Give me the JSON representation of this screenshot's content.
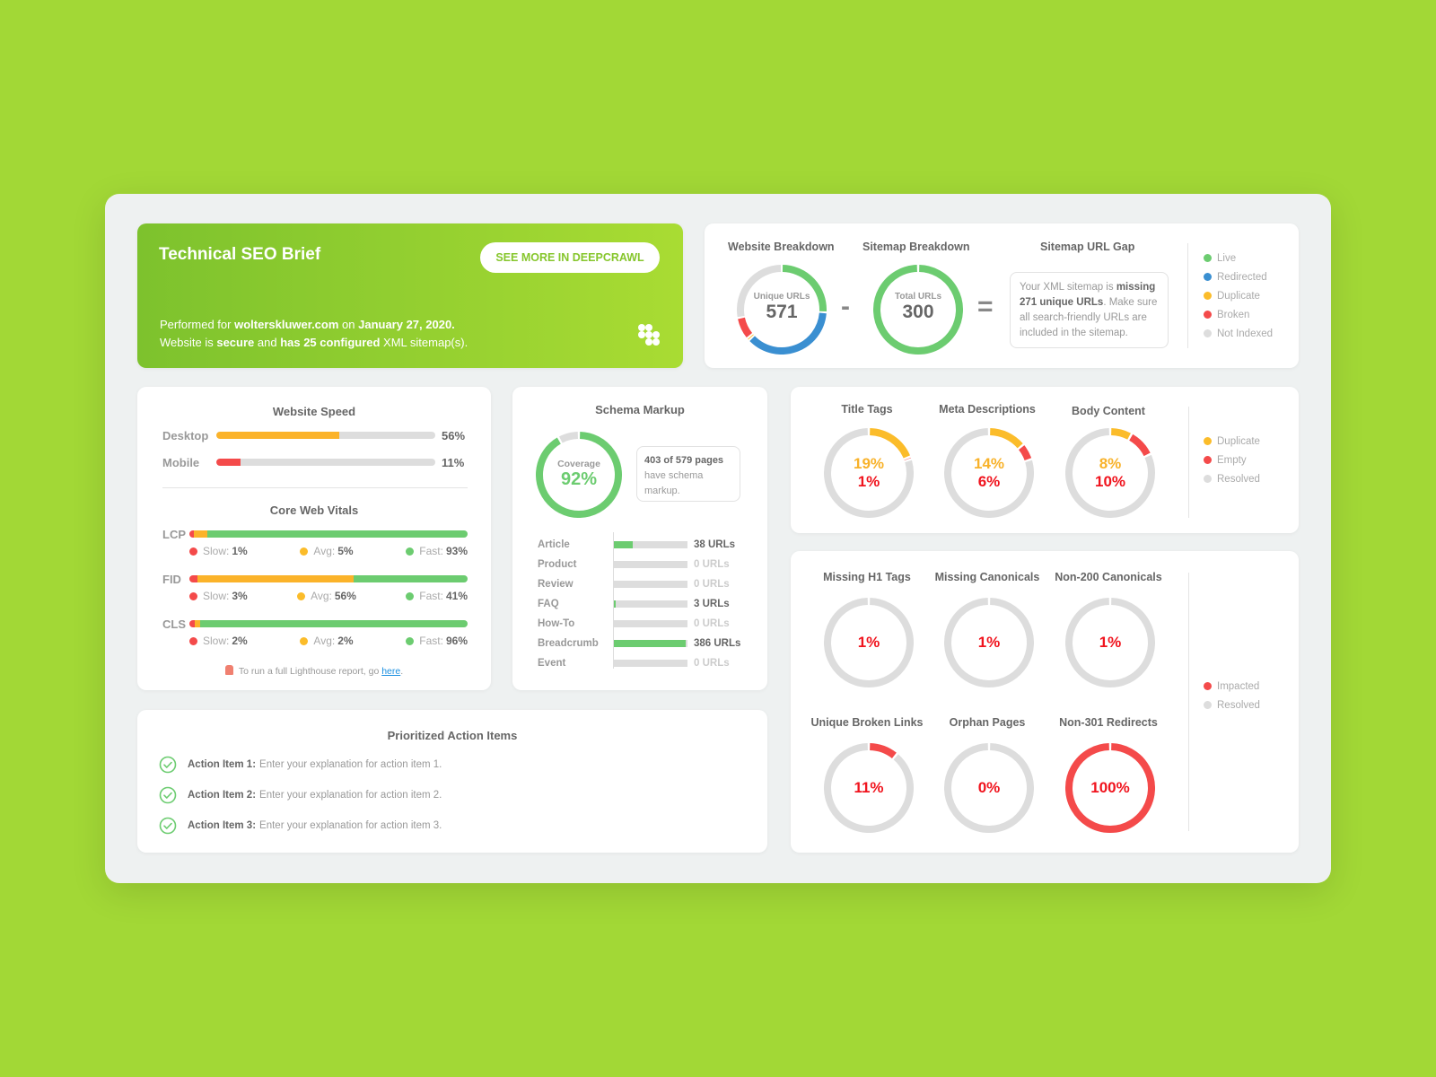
{
  "colors": {
    "green": "#6ccc70",
    "blue": "#3a8fd1",
    "yellow": "#fbbc2a",
    "red": "#f44a4a",
    "grey": "#dddddd",
    "text_red": "#f0141e",
    "text_yellow": "#f8b22a"
  },
  "hero": {
    "title": "Technical SEO Brief",
    "cta_label": "SEE MORE IN DEEPCRAWL",
    "line1_prefix": "Performed for ",
    "domain": "wolterskluwer.com",
    "line1_mid": " on ",
    "date": "January 27, 2020.",
    "line2_prefix": "Website is ",
    "secure": "secure",
    "line2_mid": " and ",
    "sitemaps": "has 25 configured",
    "line2_suffix": " XML sitemap(s).",
    "logo_icon": "deepcrawl-dots-icon"
  },
  "breakdown": {
    "website_title": "Website Breakdown",
    "website_label": "Unique URLs",
    "website_value": "571",
    "website_segments": [
      {
        "name": "Live",
        "pct": 26,
        "color": "#6ccc70"
      },
      {
        "name": "Redirected",
        "pct": 37,
        "color": "#3a8fd1"
      },
      {
        "name": "Duplicate",
        "pct": 1,
        "color": "#fbbc2a"
      },
      {
        "name": "Broken",
        "pct": 8,
        "color": "#f44a4a"
      },
      {
        "name": "Not Indexed",
        "pct": 28,
        "color": "#dddddd"
      }
    ],
    "minus": "-",
    "sitemap_title": "Sitemap Breakdown",
    "sitemap_label": "Total URLs",
    "sitemap_value": "300",
    "sitemap_segments": [
      {
        "name": "Live",
        "pct": 100,
        "color": "#6ccc70"
      }
    ],
    "equals": "=",
    "gap_title": "Sitemap URL Gap",
    "gap_text_prefix": "Your XML sitemap is ",
    "gap_text_bold": "missing 271 unique URLs",
    "gap_text_suffix": ". Make sure all search-friendly URLs are included in the sitemap.",
    "legend": [
      {
        "label": "Live",
        "color": "#6ccc70"
      },
      {
        "label": "Redirected",
        "color": "#3a8fd1"
      },
      {
        "label": "Duplicate",
        "color": "#fbbc2a"
      },
      {
        "label": "Broken",
        "color": "#f44a4a"
      },
      {
        "label": "Not Indexed",
        "color": "#dddddd"
      }
    ]
  },
  "speed": {
    "title": "Website Speed",
    "rows": [
      {
        "label": "Desktop",
        "value": "56%",
        "pct": 56,
        "color": "#fbb32a"
      },
      {
        "label": "Mobile",
        "value": "11%",
        "pct": 11,
        "color": "#f44a4a"
      }
    ],
    "cwv_title": "Core Web Vitals",
    "cwv": [
      {
        "name": "LCP",
        "slow": 1,
        "avg": 5,
        "fast": 93,
        "slow_label": "Slow:",
        "slow_value": "1%",
        "avg_label": "Avg:",
        "avg_value": "5%",
        "fast_label": "Fast:",
        "fast_value": "93%"
      },
      {
        "name": "FID",
        "slow": 3,
        "avg": 56,
        "fast": 41,
        "slow_label": "Slow:",
        "slow_value": "3%",
        "avg_label": "Avg:",
        "avg_value": "56%",
        "fast_label": "Fast:",
        "fast_value": "41%"
      },
      {
        "name": "CLS",
        "slow": 2,
        "avg": 2,
        "fast": 96,
        "slow_label": "Slow:",
        "slow_value": "2%",
        "avg_label": "Avg:",
        "avg_value": "2%",
        "fast_label": "Fast:",
        "fast_value": "96%"
      }
    ],
    "note_prefix": "To run a full Lighthouse report, go ",
    "note_link": "here",
    "note_suffix": "."
  },
  "schema": {
    "title": "Schema Markup",
    "coverage_label": "Coverage",
    "coverage_value": "92%",
    "coverage_pct": 92,
    "box_bold": "403 of 579 pages",
    "box_text": "have schema markup.",
    "rows": [
      {
        "name": "Article",
        "value": "38 URLs",
        "pct": 26,
        "active": true
      },
      {
        "name": "Product",
        "value": "0 URLs",
        "pct": 0,
        "active": false
      },
      {
        "name": "Review",
        "value": "0 URLs",
        "pct": 0,
        "active": false
      },
      {
        "name": "FAQ",
        "value": "3 URLs",
        "pct": 2,
        "active": true
      },
      {
        "name": "How-To",
        "value": "0 URLs",
        "pct": 0,
        "active": false
      },
      {
        "name": "Breadcrumb",
        "value": "386 URLs",
        "pct": 97,
        "active": true
      },
      {
        "name": "Event",
        "value": "0 URLs",
        "pct": 0,
        "active": false
      }
    ]
  },
  "content": {
    "rings": [
      {
        "title": "Title Tags",
        "duplicate": 19,
        "empty": 1,
        "duplicate_label": "19%",
        "empty_label": "1%"
      },
      {
        "title": "Meta Descriptions",
        "duplicate": 14,
        "empty": 6,
        "duplicate_label": "14%",
        "empty_label": "6%"
      },
      {
        "title": "Body Content",
        "duplicate": 8,
        "empty": 10,
        "duplicate_label": "8%",
        "empty_label": "10%"
      }
    ],
    "legend": [
      {
        "label": "Duplicate",
        "color": "#fbbc2a"
      },
      {
        "label": "Empty",
        "color": "#f44a4a"
      },
      {
        "label": "Resolved",
        "color": "#dddddd"
      }
    ]
  },
  "issues": {
    "rings": [
      {
        "title": "Missing H1 Tags",
        "impacted": 1,
        "label": "1%"
      },
      {
        "title": "Missing Canonicals",
        "impacted": 1,
        "label": "1%"
      },
      {
        "title": "Non-200 Canonicals",
        "impacted": 1,
        "label": "1%"
      },
      {
        "title": "Unique Broken Links",
        "impacted": 11,
        "label": "11%"
      },
      {
        "title": "Orphan Pages",
        "impacted": 0,
        "label": "0%"
      },
      {
        "title": "Non-301 Redirects",
        "impacted": 100,
        "label": "100%"
      }
    ],
    "legend": [
      {
        "label": "Impacted",
        "color": "#f44a4a"
      },
      {
        "label": "Resolved",
        "color": "#dddddd"
      }
    ]
  },
  "actions": {
    "title": "Prioritized Action Items",
    "items": [
      {
        "label": "Action Item 1:",
        "text": "Enter your explanation for action item 1."
      },
      {
        "label": "Action Item 2:",
        "text": "Enter your explanation for action item 2."
      },
      {
        "label": "Action Item 3:",
        "text": "Enter your explanation for action item 3."
      }
    ]
  }
}
